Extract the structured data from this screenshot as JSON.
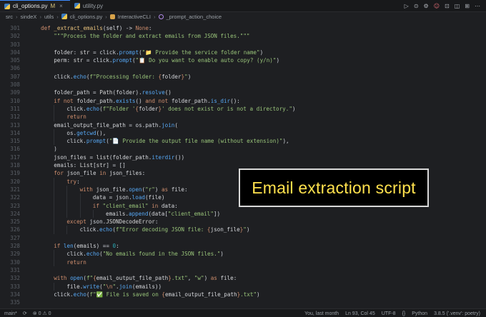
{
  "tabs": [
    {
      "label": "cli_options.py",
      "status": "M",
      "active": true
    },
    {
      "label": "utility.py",
      "status": "",
      "active": false
    }
  ],
  "tab_actions": [
    "▷",
    "⊙",
    "⚙",
    "☺",
    "⊡",
    "◫",
    "⊞",
    "⋯"
  ],
  "breadcrumb": [
    "src",
    "sindeX",
    "utils",
    "cli_options.py",
    "InteractiveCLI",
    "_prompt_action_choice"
  ],
  "lines": [
    {
      "n": "301",
      "html": "<span class=\"kw\">def</span> <span class=\"fnm\">_extract_emails</span>(<span class=\"var\">self</span>) -&gt; <span class=\"kw\">None</span>:",
      "i": 0
    },
    {
      "n": "302",
      "html": "<span class=\"str\">\"\"\"Process the folder and extract emails from JSON files.\"\"\"</span>",
      "i": 1
    },
    {
      "n": "303",
      "html": "",
      "i": 1
    },
    {
      "n": "304",
      "html": "<span class=\"var\">folder</span>: <span class=\"cls\">str</span> = click.<span class=\"fn\">prompt</span>(<span class=\"str\">\"📁 Provide the service folder name\"</span>)",
      "i": 1
    },
    {
      "n": "305",
      "html": "<span class=\"var\">perm</span>: <span class=\"cls\">str</span> = click.<span class=\"fn\">prompt</span>(<span class=\"str\">\"📋 Do you want to enable auto copy? (y/n)\"</span>)",
      "i": 1
    },
    {
      "n": "306",
      "html": "",
      "i": 1
    },
    {
      "n": "307",
      "html": "click.<span class=\"fn\">echo</span>(<span class=\"str\">f\"Processing folder: </span><span class=\"esc\">{</span><span class=\"var\">folder</span><span class=\"esc\">}</span><span class=\"str\">\"</span>)",
      "i": 1
    },
    {
      "n": "308",
      "html": "",
      "i": 1
    },
    {
      "n": "309",
      "html": "<span class=\"var\">folder_path</span> = <span class=\"cls\">Path</span>(<span class=\"var\">folder</span>).<span class=\"fn\">resolve</span>()",
      "i": 1
    },
    {
      "n": "310",
      "html": "<span class=\"kw\">if not</span> <span class=\"var\">folder_path</span>.<span class=\"fn\">exists</span>() <span class=\"kw\">and not</span> <span class=\"var\">folder_path</span>.<span class=\"fn\">is_dir</span>():",
      "i": 1
    },
    {
      "n": "311",
      "html": "click.<span class=\"fn\">echo</span>(<span class=\"str\">f\"Folder '</span><span class=\"esc\">{</span><span class=\"var\">folder</span><span class=\"esc\">}</span><span class=\"str\">' does not exist or is not a directory.\"</span>)",
      "i": 2
    },
    {
      "n": "312",
      "html": "<span class=\"kw\">return</span>",
      "i": 2
    },
    {
      "n": "313",
      "html": "<span class=\"var\">email_output_file_path</span> = os.path.<span class=\"fn\">join</span>(",
      "i": 1
    },
    {
      "n": "314",
      "html": "os.<span class=\"fn\">getcwd</span>(),",
      "i": 2
    },
    {
      "n": "315",
      "html": "click.<span class=\"fn\">prompt</span>(<span class=\"str\">\"📄 Provide the output file name (without extension)\"</span>),",
      "i": 2
    },
    {
      "n": "316",
      "html": ")",
      "i": 1
    },
    {
      "n": "317",
      "html": "<span class=\"var\">json_files</span> = <span class=\"cls\">list</span>(<span class=\"var\">folder_path</span>.<span class=\"fn\">iterdir</span>())",
      "i": 1
    },
    {
      "n": "318",
      "html": "<span class=\"var\">emails</span>: <span class=\"cls\">List</span>[<span class=\"cls\">str</span>] = []",
      "i": 1
    },
    {
      "n": "319",
      "html": "<span class=\"kw\">for</span> <span class=\"var\">json_file</span> <span class=\"kw\">in</span> <span class=\"var\">json_files</span>:",
      "i": 1
    },
    {
      "n": "320",
      "html": "<span class=\"kw\">try</span>:",
      "i": 2
    },
    {
      "n": "321",
      "html": "<span class=\"kw\">with</span> <span class=\"var\">json_file</span>.<span class=\"fn\">open</span>(<span class=\"str\">\"r\"</span>) <span class=\"kw\">as</span> <span class=\"var\">file</span>:",
      "i": 3
    },
    {
      "n": "322",
      "html": "<span class=\"var\">data</span> = json.<span class=\"fn\">load</span>(<span class=\"var\">file</span>)",
      "i": 4
    },
    {
      "n": "323",
      "html": "<span class=\"kw\">if</span> <span class=\"str\">\"client_email\"</span> <span class=\"kw\">in</span> <span class=\"var\">data</span>:",
      "i": 4
    },
    {
      "n": "324",
      "html": "<span class=\"var\">emails</span>.<span class=\"fn\">append</span>(<span class=\"var\">data</span>[<span class=\"str\">\"client_email\"</span>])",
      "i": 5
    },
    {
      "n": "325",
      "html": "<span class=\"kw\">except</span> json.<span class=\"cls\">JSONDecodeError</span>:",
      "i": 2
    },
    {
      "n": "326",
      "html": "click.<span class=\"fn\">echo</span>(<span class=\"str\">f\"Error decoding JSON file: </span><span class=\"esc\">{</span><span class=\"var\">json_file</span><span class=\"esc\">}</span><span class=\"str\">\"</span>)",
      "i": 3
    },
    {
      "n": "327",
      "html": "",
      "i": 1
    },
    {
      "n": "328",
      "html": "<span class=\"kw\">if</span> <span class=\"fn\">len</span>(<span class=\"var\">emails</span>) == <span class=\"num\">0</span>:",
      "i": 1
    },
    {
      "n": "329",
      "html": "click.<span class=\"fn\">echo</span>(<span class=\"str\">\"No emails found in the JSON files.\"</span>)",
      "i": 2
    },
    {
      "n": "330",
      "html": "<span class=\"kw\">return</span>",
      "i": 2
    },
    {
      "n": "331",
      "html": "",
      "i": 1
    },
    {
      "n": "332",
      "html": "<span class=\"kw\">with</span> <span class=\"fn\">open</span>(<span class=\"str\">f\"</span><span class=\"esc\">{</span><span class=\"var\">email_output_file_path</span><span class=\"esc\">}</span><span class=\"str\">.txt\"</span>, <span class=\"str\">\"w\"</span>) <span class=\"kw\">as</span> <span class=\"var\">file</span>:",
      "i": 1
    },
    {
      "n": "333",
      "html": "<span class=\"var\">file</span>.<span class=\"fn\">write</span>(<span class=\"str\">\"</span><span class=\"esc\">\\n</span><span class=\"str\">\"</span>.<span class=\"fn\">join</span>(<span class=\"var\">emails</span>))",
      "i": 2
    },
    {
      "n": "334",
      "html": "click.<span class=\"fn\">echo</span>(<span class=\"str\">f\"✅ File is saved on </span><span class=\"esc\">{</span><span class=\"var\">email_output_file_path</span><span class=\"esc\">}</span><span class=\"str\">.txt\"</span>)",
      "i": 1
    },
    {
      "n": "335",
      "html": "",
      "i": 1
    }
  ],
  "callout_text": "Email extraction script",
  "status": {
    "branch": "main*",
    "sync": "⟳",
    "problems": "⊗ 0 ⚠ 0",
    "blame": "You, last month",
    "position": "Ln 93, Col 45",
    "encoding": "UTF-8",
    "eol": "{}",
    "language": "Python",
    "interpreter": "3.8.5 ('.venv': poetry)"
  }
}
